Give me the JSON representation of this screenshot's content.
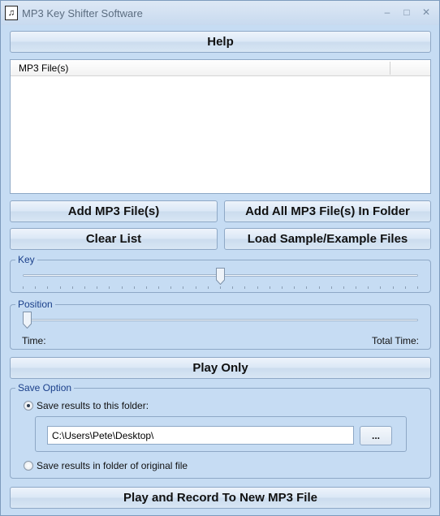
{
  "window": {
    "title": "MP3 Key Shifter Software",
    "controls": {
      "minimize": "–",
      "maximize": "□",
      "close": "✕"
    }
  },
  "toolbar": {
    "help_label": "Help"
  },
  "file_list": {
    "column_header": "MP3 File(s)",
    "rows": []
  },
  "buttons": {
    "add_files": "Add MP3 File(s)",
    "add_folder": "Add All MP3 File(s) In Folder",
    "clear_list": "Clear List",
    "load_sample": "Load Sample/Example Files",
    "play_only": "Play Only",
    "play_record": "Play and Record To New MP3 File",
    "browse": "..."
  },
  "key": {
    "label": "Key",
    "value_fraction": 0.5
  },
  "position": {
    "label": "Position",
    "value_fraction": 0.0,
    "time_label": "Time:",
    "total_time_label": "Total Time:"
  },
  "save_option": {
    "label": "Save Option",
    "option_folder": "Save results to this folder:",
    "option_original": "Save results in folder of original file",
    "selected": "folder",
    "folder_path": "C:\\Users\\Pete\\Desktop\\"
  }
}
